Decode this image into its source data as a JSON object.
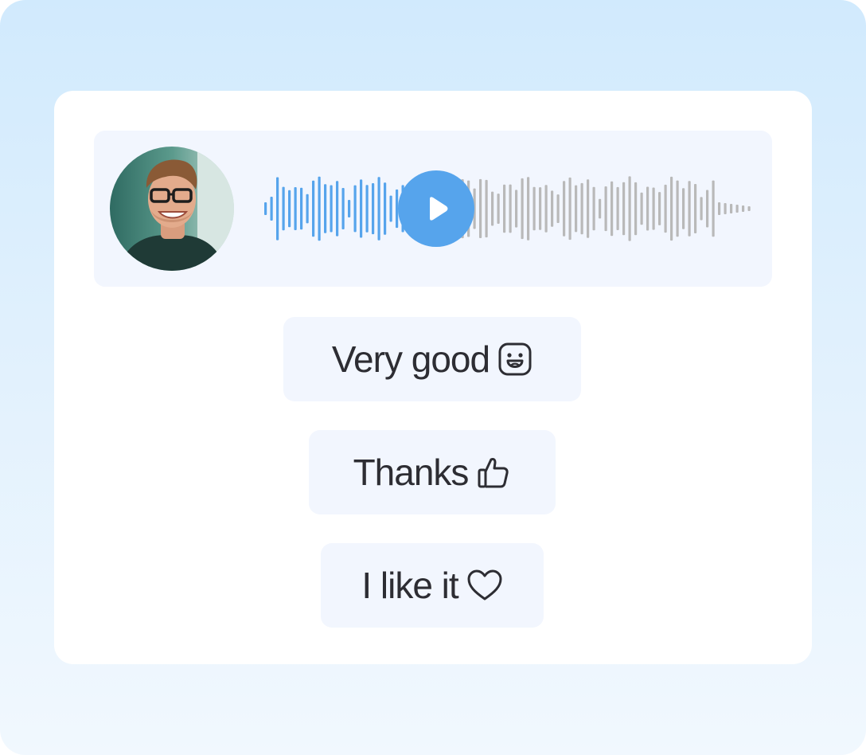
{
  "voice_message": {
    "played_fraction": 0.37
  },
  "quick_replies": [
    {
      "label": "Very good",
      "icon": "grinning-face-icon"
    },
    {
      "label": "Thanks",
      "icon": "thumbs-up-icon"
    },
    {
      "label": "I like it",
      "icon": "heart-icon"
    }
  ],
  "colors": {
    "played_wave": "#56a4ec",
    "unplayed_wave": "#b9b9b9",
    "play_button": "#56a4ec",
    "reply_background": "#f2f6fe",
    "text": "#2d2d33"
  }
}
